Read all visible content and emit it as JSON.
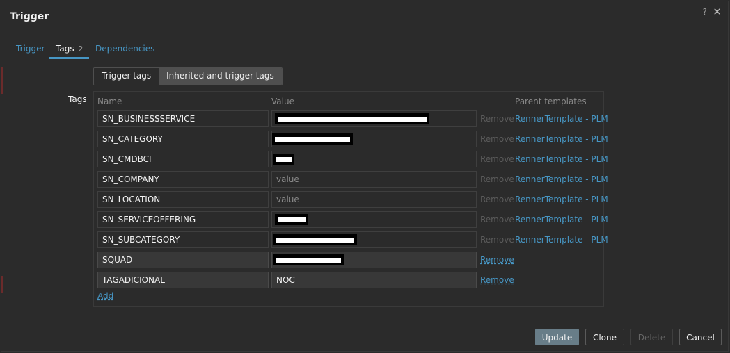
{
  "dialog": {
    "title": "Trigger",
    "help_icon": "?",
    "close_icon": "✕"
  },
  "tabs": [
    {
      "label": "Trigger"
    },
    {
      "label": "Tags",
      "count": "2"
    },
    {
      "label": "Dependencies"
    }
  ],
  "segment": {
    "options": [
      "Trigger tags",
      "Inherited and trigger tags"
    ],
    "selected": "Inherited and trigger tags"
  },
  "tags_section": {
    "label": "Tags",
    "headers": {
      "name": "Name",
      "value": "Value",
      "parent": "Parent templates"
    },
    "rows": [
      {
        "name": "SN_BUSINESSSERVICE",
        "value": "",
        "remove": "Remove",
        "parent": "RennerTemplate - PLM"
      },
      {
        "name": "SN_CATEGORY",
        "value": "",
        "remove": "Remove",
        "parent": "RennerTemplate - PLM"
      },
      {
        "name": "SN_CMDBCI",
        "value": "",
        "remove": "Remove",
        "parent": "RennerTemplate - PLM"
      },
      {
        "name": "SN_COMPANY",
        "value_placeholder": "value",
        "remove": "Remove",
        "parent": "RennerTemplate - PLM"
      },
      {
        "name": "SN_LOCATION",
        "value_placeholder": "value",
        "remove": "Remove",
        "parent": "RennerTemplate - PLM"
      },
      {
        "name": "SN_SERVICEOFFERING",
        "value": "",
        "remove": "Remove",
        "parent": "RennerTemplate - PLM"
      },
      {
        "name": "SN_SUBCATEGORY",
        "value": "",
        "remove": "Remove",
        "parent": "RennerTemplate - PLM"
      },
      {
        "name": "SQUAD",
        "value": "",
        "remove": "Remove"
      },
      {
        "name": "TAGADICIONAL",
        "value": "NOC",
        "remove": "Remove"
      }
    ],
    "add_label": "Add"
  },
  "footer": {
    "update": "Update",
    "clone": "Clone",
    "delete": "Delete",
    "cancel": "Cancel"
  },
  "colors": {
    "link": "#4796c4",
    "primary_button": "#687d88",
    "background": "#2b2b2b"
  }
}
